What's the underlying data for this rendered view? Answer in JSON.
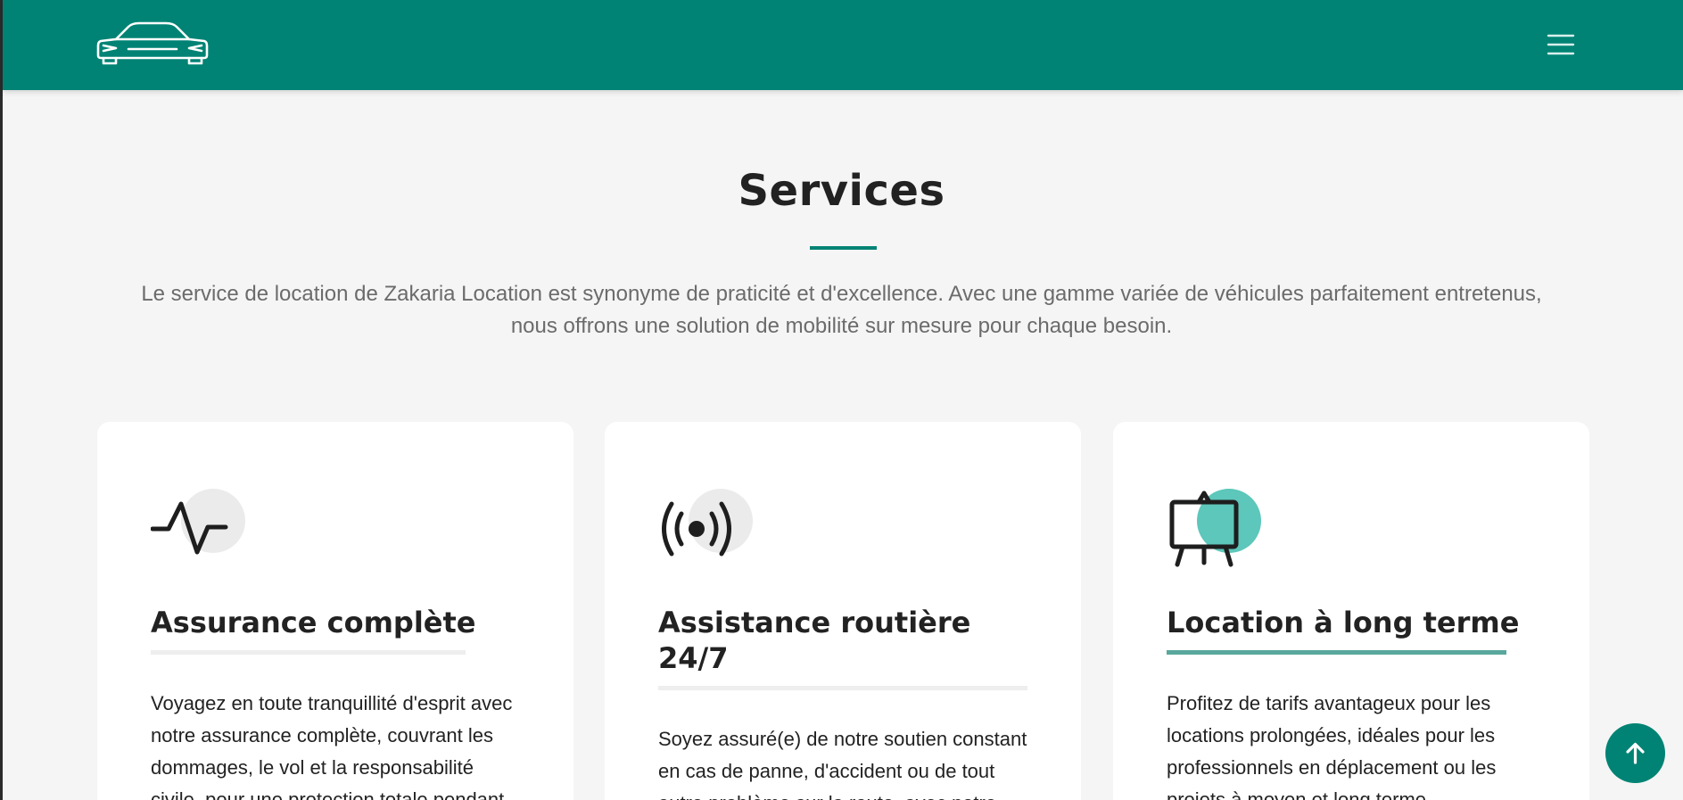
{
  "header": {
    "logo_icon": "car-outline-icon",
    "menu_icon": "hamburger-menu-icon",
    "background_color": "#008374"
  },
  "services": {
    "title": "Services",
    "description_line1": "Le service de location de Zakaria Location est synonyme de praticité et d'excellence. Avec une gamme variée de véhicules parfaitement entretenus,",
    "description_line2": "nous offrons une solution de mobilité sur mesure pour chaque besoin.",
    "cards": [
      {
        "icon": "activity-pulse-icon",
        "title": "Assurance complète",
        "text": "Voyagez en toute tranquillité d'esprit avec notre assurance complète, couvrant les dommages, le vol et la responsabilité civile, pour une protection totale pendant"
      },
      {
        "icon": "broadcast-signal-icon",
        "title_line1": "Assistance routière",
        "title_line2": "24/7",
        "text": "Soyez assuré(e) de notre soutien constant en cas de panne, d'accident ou de tout autre problème sur la route, avec notre"
      },
      {
        "icon": "easel-presentation-icon",
        "title": "Location à long terme",
        "text": "Profitez de tarifs avantageux pour les locations prolongées, idéales pour les professionnels en déplacement ou les projets à moyen et long terme."
      }
    ]
  },
  "scroll_top": {
    "icon": "arrow-up-icon"
  },
  "colors": {
    "accent": "#008374",
    "accent_light": "#5cc7ba",
    "page_bg": "#f5f5f5"
  }
}
